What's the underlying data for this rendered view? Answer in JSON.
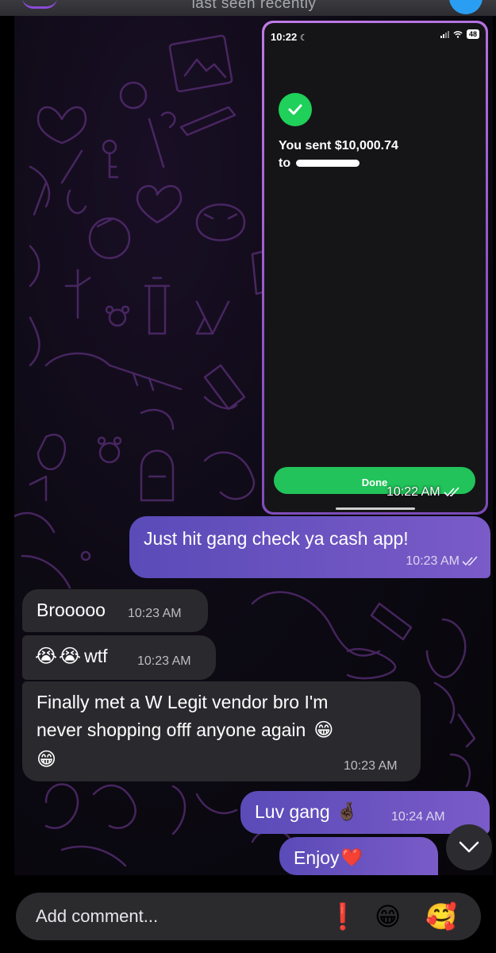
{
  "header": {
    "subtitle": "last seen recently"
  },
  "screenshot": {
    "status_time": "10:22",
    "battery": "48",
    "sent_line1": "You sent $10,000.74",
    "sent_line2": "to",
    "done_label": "Done",
    "timestamp": "10:22 AM"
  },
  "messages": [
    {
      "side": "out",
      "text": "Just hit gang check ya cash app!",
      "time": "10:23 AM"
    },
    {
      "side": "in",
      "text": "Brooooo",
      "time": "10:23 AM"
    },
    {
      "side": "in",
      "emoji": "😭😭",
      "text": "wtf",
      "time": "10:23 AM"
    },
    {
      "side": "in",
      "line1": "Finally met a W Legit vendor bro I'm",
      "line2": "never shopping offf anyone again",
      "emoji1": "😁",
      "emoji2": "😁",
      "time": "10:23 AM"
    },
    {
      "side": "out",
      "text": "Luv gang",
      "emoji": "🤞🏿",
      "time": "10:24 AM"
    },
    {
      "side": "out",
      "text": "Enjoy",
      "emoji": "❤️"
    }
  ],
  "comment": {
    "placeholder": "Add comment...",
    "reactions": [
      "❗",
      "😁",
      "🥰"
    ]
  },
  "colors": {
    "outgoing_bubble": "#6a52c0",
    "incoming_bubble": "#2a2a2e",
    "cashapp_green": "#21c35a",
    "background": "#000000"
  },
  "icons": [
    "check-icon",
    "double-check-icon",
    "chevron-down-icon",
    "signal-icon",
    "wifi-icon",
    "battery-icon",
    "moon-icon"
  ]
}
